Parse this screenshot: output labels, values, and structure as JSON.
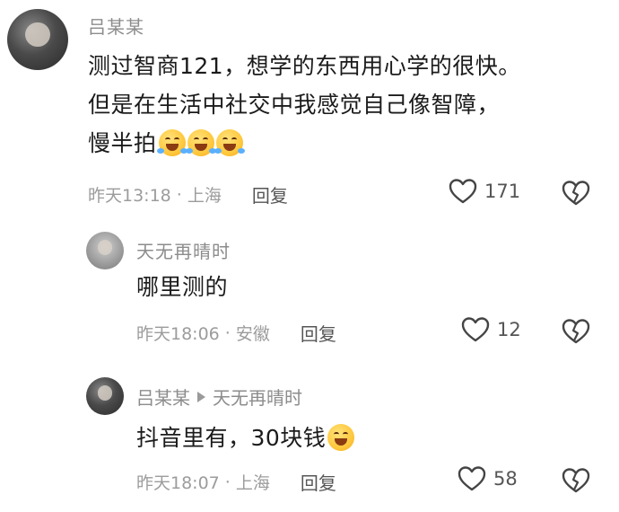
{
  "comments": [
    {
      "username": "吕某某",
      "content_lines": [
        "测过智商121，想学的东西用心学的很快。",
        "但是在生活中社交中我感觉自己像智障，",
        "慢半拍"
      ],
      "emoji": "laughing-tears-emoji",
      "time": "昨天13:18",
      "location": "上海",
      "reply_label": "回复",
      "likes": "171"
    },
    {
      "username": "天无再晴时",
      "content": "哪里测的",
      "time": "昨天18:06",
      "location": "安徽",
      "reply_label": "回复",
      "likes": "12"
    },
    {
      "username": "吕某某",
      "reply_to": "天无再晴时",
      "content": "抖音里有，30块钱",
      "emoji": "grinning-emoji",
      "time": "昨天18:07",
      "location": "上海",
      "reply_label": "回复",
      "likes": "58"
    }
  ],
  "separator": "·",
  "icons": {
    "like": "heart-outline-icon",
    "dislike": "broken-heart-icon"
  }
}
